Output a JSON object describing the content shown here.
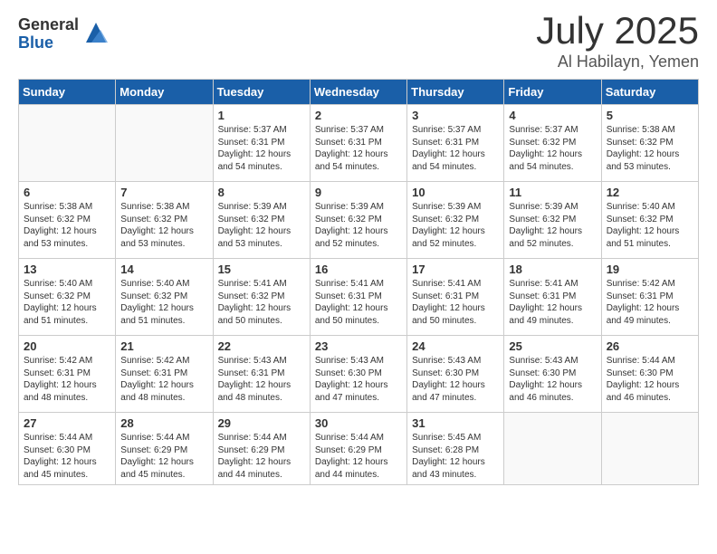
{
  "logo": {
    "general": "General",
    "blue": "Blue"
  },
  "title": {
    "month": "July 2025",
    "location": "Al Habilayn, Yemen"
  },
  "weekdays": [
    "Sunday",
    "Monday",
    "Tuesday",
    "Wednesday",
    "Thursday",
    "Friday",
    "Saturday"
  ],
  "weeks": [
    [
      {
        "day": "",
        "info": ""
      },
      {
        "day": "",
        "info": ""
      },
      {
        "day": "1",
        "info": "Sunrise: 5:37 AM\nSunset: 6:31 PM\nDaylight: 12 hours and 54 minutes."
      },
      {
        "day": "2",
        "info": "Sunrise: 5:37 AM\nSunset: 6:31 PM\nDaylight: 12 hours and 54 minutes."
      },
      {
        "day": "3",
        "info": "Sunrise: 5:37 AM\nSunset: 6:31 PM\nDaylight: 12 hours and 54 minutes."
      },
      {
        "day": "4",
        "info": "Sunrise: 5:37 AM\nSunset: 6:32 PM\nDaylight: 12 hours and 54 minutes."
      },
      {
        "day": "5",
        "info": "Sunrise: 5:38 AM\nSunset: 6:32 PM\nDaylight: 12 hours and 53 minutes."
      }
    ],
    [
      {
        "day": "6",
        "info": "Sunrise: 5:38 AM\nSunset: 6:32 PM\nDaylight: 12 hours and 53 minutes."
      },
      {
        "day": "7",
        "info": "Sunrise: 5:38 AM\nSunset: 6:32 PM\nDaylight: 12 hours and 53 minutes."
      },
      {
        "day": "8",
        "info": "Sunrise: 5:39 AM\nSunset: 6:32 PM\nDaylight: 12 hours and 53 minutes."
      },
      {
        "day": "9",
        "info": "Sunrise: 5:39 AM\nSunset: 6:32 PM\nDaylight: 12 hours and 52 minutes."
      },
      {
        "day": "10",
        "info": "Sunrise: 5:39 AM\nSunset: 6:32 PM\nDaylight: 12 hours and 52 minutes."
      },
      {
        "day": "11",
        "info": "Sunrise: 5:39 AM\nSunset: 6:32 PM\nDaylight: 12 hours and 52 minutes."
      },
      {
        "day": "12",
        "info": "Sunrise: 5:40 AM\nSunset: 6:32 PM\nDaylight: 12 hours and 51 minutes."
      }
    ],
    [
      {
        "day": "13",
        "info": "Sunrise: 5:40 AM\nSunset: 6:32 PM\nDaylight: 12 hours and 51 minutes."
      },
      {
        "day": "14",
        "info": "Sunrise: 5:40 AM\nSunset: 6:32 PM\nDaylight: 12 hours and 51 minutes."
      },
      {
        "day": "15",
        "info": "Sunrise: 5:41 AM\nSunset: 6:32 PM\nDaylight: 12 hours and 50 minutes."
      },
      {
        "day": "16",
        "info": "Sunrise: 5:41 AM\nSunset: 6:31 PM\nDaylight: 12 hours and 50 minutes."
      },
      {
        "day": "17",
        "info": "Sunrise: 5:41 AM\nSunset: 6:31 PM\nDaylight: 12 hours and 50 minutes."
      },
      {
        "day": "18",
        "info": "Sunrise: 5:41 AM\nSunset: 6:31 PM\nDaylight: 12 hours and 49 minutes."
      },
      {
        "day": "19",
        "info": "Sunrise: 5:42 AM\nSunset: 6:31 PM\nDaylight: 12 hours and 49 minutes."
      }
    ],
    [
      {
        "day": "20",
        "info": "Sunrise: 5:42 AM\nSunset: 6:31 PM\nDaylight: 12 hours and 48 minutes."
      },
      {
        "day": "21",
        "info": "Sunrise: 5:42 AM\nSunset: 6:31 PM\nDaylight: 12 hours and 48 minutes."
      },
      {
        "day": "22",
        "info": "Sunrise: 5:43 AM\nSunset: 6:31 PM\nDaylight: 12 hours and 48 minutes."
      },
      {
        "day": "23",
        "info": "Sunrise: 5:43 AM\nSunset: 6:30 PM\nDaylight: 12 hours and 47 minutes."
      },
      {
        "day": "24",
        "info": "Sunrise: 5:43 AM\nSunset: 6:30 PM\nDaylight: 12 hours and 47 minutes."
      },
      {
        "day": "25",
        "info": "Sunrise: 5:43 AM\nSunset: 6:30 PM\nDaylight: 12 hours and 46 minutes."
      },
      {
        "day": "26",
        "info": "Sunrise: 5:44 AM\nSunset: 6:30 PM\nDaylight: 12 hours and 46 minutes."
      }
    ],
    [
      {
        "day": "27",
        "info": "Sunrise: 5:44 AM\nSunset: 6:30 PM\nDaylight: 12 hours and 45 minutes."
      },
      {
        "day": "28",
        "info": "Sunrise: 5:44 AM\nSunset: 6:29 PM\nDaylight: 12 hours and 45 minutes."
      },
      {
        "day": "29",
        "info": "Sunrise: 5:44 AM\nSunset: 6:29 PM\nDaylight: 12 hours and 44 minutes."
      },
      {
        "day": "30",
        "info": "Sunrise: 5:44 AM\nSunset: 6:29 PM\nDaylight: 12 hours and 44 minutes."
      },
      {
        "day": "31",
        "info": "Sunrise: 5:45 AM\nSunset: 6:28 PM\nDaylight: 12 hours and 43 minutes."
      },
      {
        "day": "",
        "info": ""
      },
      {
        "day": "",
        "info": ""
      }
    ]
  ]
}
